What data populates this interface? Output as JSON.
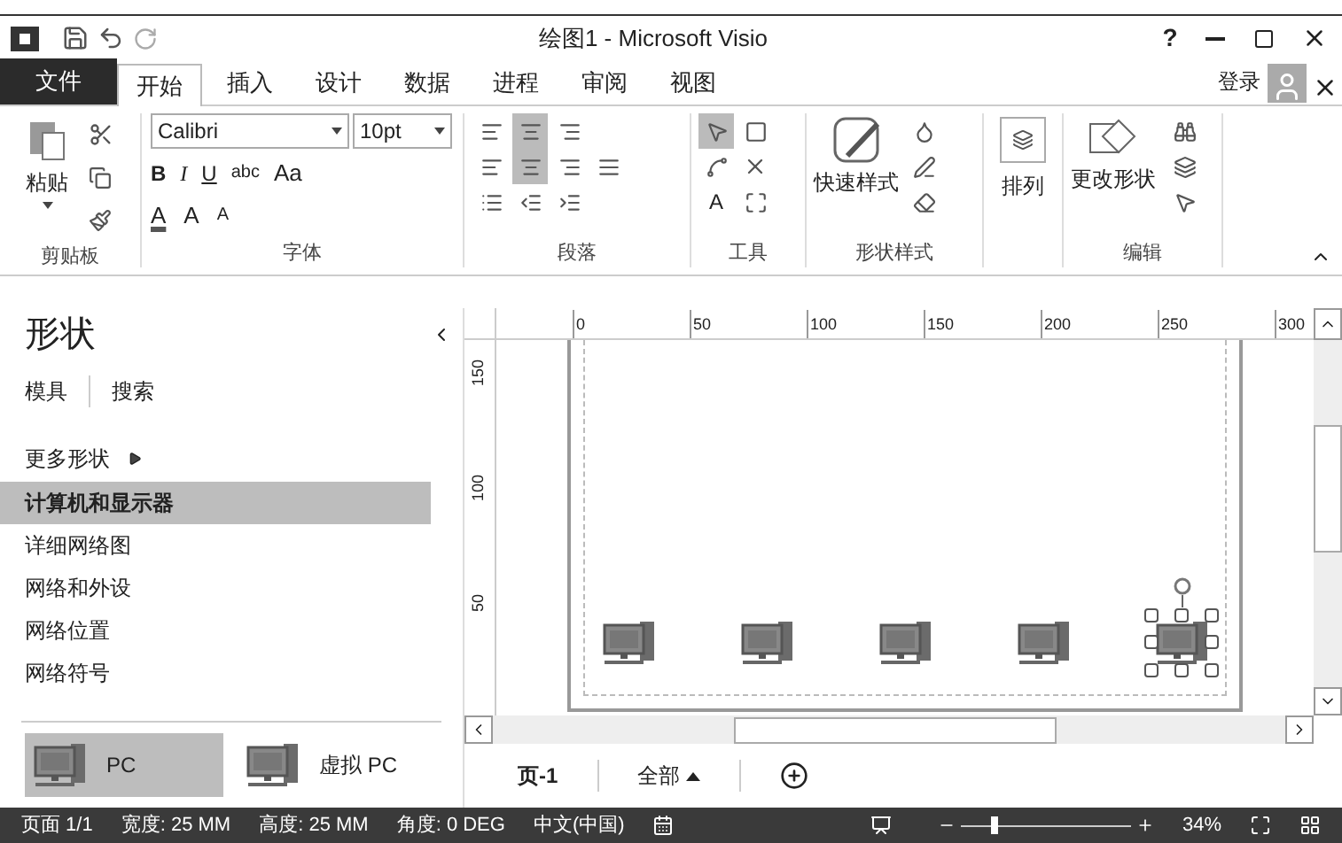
{
  "window": {
    "title": "绘图1 - Microsoft Visio",
    "help": "?"
  },
  "tabs": [
    {
      "label": "文件",
      "kind": "file",
      "selected": false
    },
    {
      "label": "开始",
      "kind": "tab",
      "selected": true
    },
    {
      "label": "插入",
      "kind": "tab",
      "selected": false
    },
    {
      "label": "设计",
      "kind": "tab",
      "selected": false
    },
    {
      "label": "数据",
      "kind": "tab",
      "selected": false
    },
    {
      "label": "进程",
      "kind": "tab",
      "selected": false
    },
    {
      "label": "审阅",
      "kind": "tab",
      "selected": false
    },
    {
      "label": "视图",
      "kind": "tab",
      "selected": false
    }
  ],
  "account": {
    "login": "登录"
  },
  "ribbon": {
    "clipboard": {
      "paste": "粘贴",
      "label": "剪贴板"
    },
    "font": {
      "name": "Calibri",
      "size": "10pt",
      "styles": [
        "B",
        "I",
        "U",
        "abc",
        "Aa"
      ],
      "color_button": "A",
      "grow": "A",
      "shrink": "A",
      "label": "字体"
    },
    "paragraph": {
      "label": "段落"
    },
    "tools": {
      "text": "A",
      "label": "工具"
    },
    "shape_styles": {
      "quick": "快速样式",
      "label": "形状样式"
    },
    "arrange": {
      "button": "排列"
    },
    "editing": {
      "change_shape": "更改形状",
      "label": "编辑"
    }
  },
  "shapes_pane": {
    "title": "形状",
    "links": [
      "模具",
      "搜索"
    ],
    "more": "更多形状",
    "stencils": [
      {
        "label": "计算机和显示器",
        "selected": true
      },
      {
        "label": "详细网络图",
        "selected": false
      },
      {
        "label": "网络和外设",
        "selected": false
      },
      {
        "label": "网络位置",
        "selected": false
      },
      {
        "label": "网络符号",
        "selected": false
      }
    ],
    "masters": [
      {
        "label": "PC",
        "selected": true
      },
      {
        "label": "虚拟 PC",
        "selected": false
      }
    ]
  },
  "canvas": {
    "h_ruler": [
      "0",
      "50",
      "100",
      "150",
      "200",
      "250",
      "300"
    ],
    "v_ruler": [
      "150",
      "100",
      "50"
    ],
    "shapes": [
      {
        "selected": false
      },
      {
        "selected": false
      },
      {
        "selected": false
      },
      {
        "selected": false
      },
      {
        "selected": true
      }
    ]
  },
  "page_tabs": {
    "page": "页-1",
    "all": "全部"
  },
  "status_bar": {
    "items": [
      "页面 1/1",
      "宽度: 25 MM",
      "高度: 25 MM",
      "角度: 0 DEG",
      "中文(中国)"
    ],
    "zoom": {
      "level": 0.2,
      "reading": "34%"
    }
  }
}
